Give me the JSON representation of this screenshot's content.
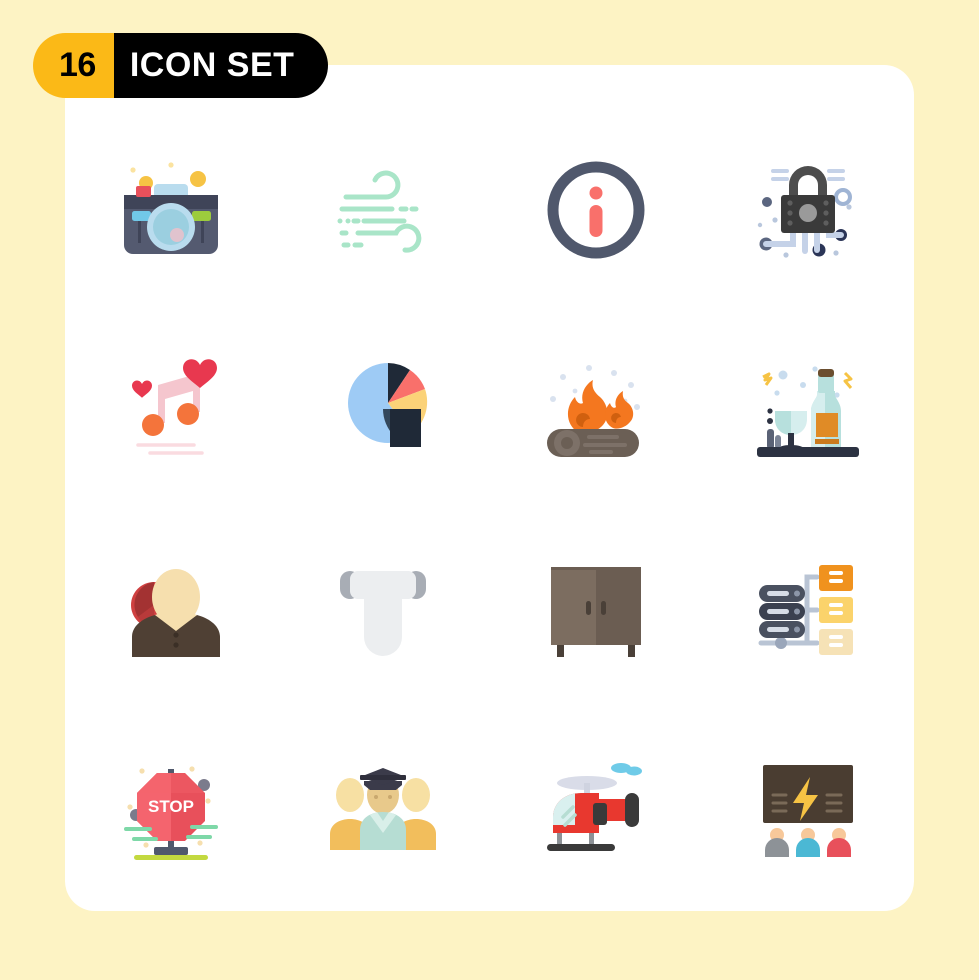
{
  "page": {
    "background_color": "#fdf3c4",
    "card_color": "#ffffff"
  },
  "banner": {
    "count": "16",
    "title": "ICON SET",
    "count_bg": "#fbb917",
    "count_fg": "#000000",
    "title_bg": "#000000",
    "title_fg": "#ffffff"
  },
  "grid": {
    "columns": 4,
    "rows": 4,
    "total_icons": 16,
    "icons": [
      {
        "index": 1,
        "name": "camera-icon",
        "label": "Camera",
        "row": 1,
        "col": 1,
        "colors": [
          "#3f4458",
          "#545a70",
          "#b3e0ec",
          "#e8505b",
          "#8bc34a",
          "#f6c344"
        ]
      },
      {
        "index": 2,
        "name": "wind-icon",
        "label": "Wind",
        "row": 1,
        "col": 2,
        "colors": [
          "#a9e5c8"
        ]
      },
      {
        "index": 3,
        "name": "info-icon",
        "label": "Info",
        "row": 1,
        "col": 3,
        "colors": [
          "#50586c",
          "#f9706b"
        ]
      },
      {
        "index": 4,
        "name": "cyber-security-lock-icon",
        "label": "Cyber Security",
        "row": 1,
        "col": 4,
        "colors": [
          "#3a3a3a",
          "#c5d2e8",
          "#2b3557",
          "#77a5d8",
          "#b9c7dd"
        ]
      },
      {
        "index": 5,
        "name": "love-music-note-icon",
        "label": "Love Music",
        "row": 2,
        "col": 1,
        "colors": [
          "#f5c6ce",
          "#e8384f",
          "#f4743b",
          "#fadbe0"
        ]
      },
      {
        "index": 6,
        "name": "pie-chart-icon",
        "label": "Pie Chart",
        "row": 2,
        "col": 2,
        "colors": [
          "#9ecbf5",
          "#1f2937",
          "#34485c",
          "#f9706b",
          "#fbd278"
        ]
      },
      {
        "index": 7,
        "name": "campfire-icon",
        "label": "Campfire",
        "row": 2,
        "col": 3,
        "colors": [
          "#6b5f55",
          "#7d7168",
          "#f4771f",
          "#d9e2ef"
        ]
      },
      {
        "index": 8,
        "name": "liquor-bottle-icon",
        "label": "Bar Drinks",
        "row": 2,
        "col": 4,
        "colors": [
          "#b7e0dd",
          "#d6eeee",
          "#e08b26",
          "#2c3242",
          "#f6c344"
        ]
      },
      {
        "index": 9,
        "name": "user-profile-icon",
        "label": "User Profile",
        "row": 3,
        "col": 1,
        "colors": [
          "#cf4040",
          "#a33232",
          "#f6dfae",
          "#4f4034"
        ]
      },
      {
        "index": 10,
        "name": "toilet-paper-icon",
        "label": "Toilet Paper",
        "row": 3,
        "col": 2,
        "colors": [
          "#eceef0",
          "#a8adb5"
        ]
      },
      {
        "index": 11,
        "name": "cabinet-icon",
        "label": "Cabinet",
        "row": 3,
        "col": 3,
        "colors": [
          "#7c6d60",
          "#6b5d52",
          "#4a4038"
        ]
      },
      {
        "index": 12,
        "name": "server-network-icon",
        "label": "Server Network",
        "row": 3,
        "col": 4,
        "colors": [
          "#4a5160",
          "#b9c4d4",
          "#f0921e",
          "#fbd36b",
          "#f6e2b6"
        ]
      },
      {
        "index": 13,
        "name": "stop-sign-icon",
        "label": "Stop Sign",
        "row": 4,
        "col": 1,
        "colors": [
          "#e8505b",
          "#c9434d",
          "#ffffff",
          "#50586c",
          "#7ed8a8",
          "#c3d93f"
        ],
        "text": "STOP"
      },
      {
        "index": 14,
        "name": "team-group-icon",
        "label": "Team Group",
        "row": 4,
        "col": 2,
        "colors": [
          "#f2be5c",
          "#f7e0a3",
          "#e8c98b",
          "#b6ddd3",
          "#3b3b4a"
        ]
      },
      {
        "index": 15,
        "name": "helicopter-icon",
        "label": "Helicopter",
        "row": 4,
        "col": 3,
        "colors": [
          "#e8382f",
          "#d9dce8",
          "#d9f0ef",
          "#3a3a3a",
          "#6fcbe8"
        ]
      },
      {
        "index": 16,
        "name": "presentation-power-icon",
        "label": "Power Presentation",
        "row": 4,
        "col": 4,
        "colors": [
          "#4a3d31",
          "#f6c344",
          "#f7c89a",
          "#8d9297",
          "#4bb8d4",
          "#e8505b"
        ]
      }
    ]
  }
}
